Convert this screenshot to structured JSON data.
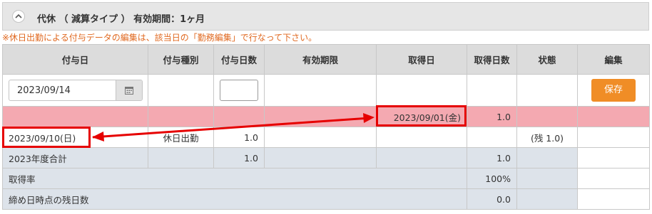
{
  "panel": {
    "title": "代休 （ 減算タイプ ） 有効期間：1ヶ月",
    "notice": "※休日出勤による付与データの編集は、該当日の「勤務編集」で行なって下さい。"
  },
  "table": {
    "headers": {
      "grant_date": "付与日",
      "grant_type": "付与種別",
      "grant_days": "付与日数",
      "expiry": "有効期限",
      "acquired_date": "取得日",
      "acquired_days": "取得日数",
      "status": "状態",
      "edit": "編集"
    },
    "input_row": {
      "grant_date_value": "2023/09/14",
      "grant_days_value": "",
      "save_label": "保存"
    },
    "highlight_row": {
      "acquired_date": "2023/09/01(金)",
      "acquired_days": "1.0"
    },
    "data_row": {
      "grant_date": "2023/09/10(日)",
      "grant_type": "休日出勤",
      "grant_days": "1.0",
      "status": "(残 1.0)"
    },
    "summary": {
      "fiscal_total_label": "2023年度合計",
      "fiscal_total_grant_days": "1.0",
      "fiscal_total_acquired_days": "1.0",
      "acquisition_rate_label": "取得率",
      "acquisition_rate_value": "100%",
      "remaining_label": "締め日時点の残日数",
      "remaining_value": "0.0"
    }
  },
  "colors": {
    "highlight_row": "#f4a9b1",
    "save_button": "#f08d26",
    "annotation": "#e60000",
    "notice_text": "#e0681f"
  }
}
